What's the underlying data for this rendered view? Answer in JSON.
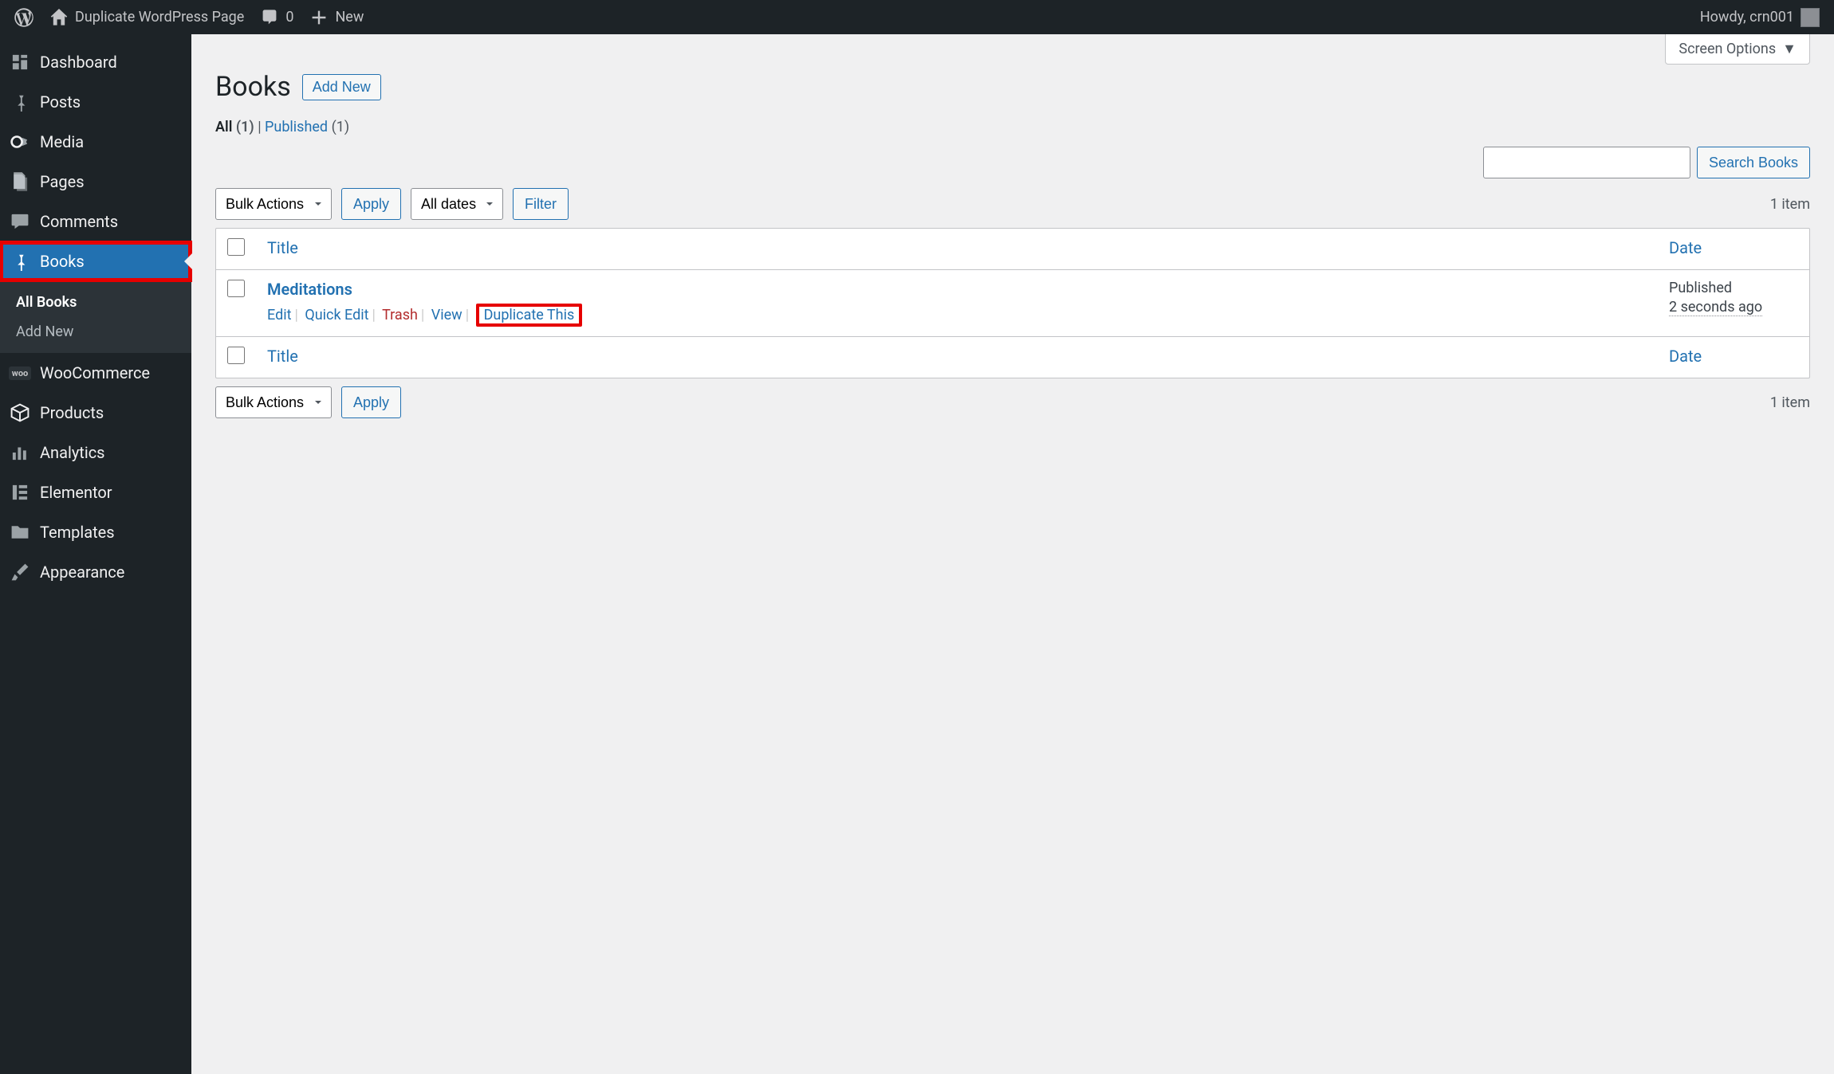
{
  "adminbar": {
    "site_title": "Duplicate WordPress Page",
    "comments_count": "0",
    "new_label": "New",
    "howdy": "Howdy, crn001"
  },
  "sidebar": {
    "items": [
      {
        "label": "Dashboard",
        "icon": "dashboard"
      },
      {
        "label": "Posts",
        "icon": "pin"
      },
      {
        "label": "Media",
        "icon": "media"
      },
      {
        "label": "Pages",
        "icon": "pages"
      },
      {
        "label": "Comments",
        "icon": "comment"
      },
      {
        "label": "Books",
        "icon": "pin",
        "current": true,
        "highlight": true
      },
      {
        "label": "WooCommerce",
        "icon": "woo"
      },
      {
        "label": "Products",
        "icon": "product"
      },
      {
        "label": "Analytics",
        "icon": "analytics"
      },
      {
        "label": "Elementor",
        "icon": "elementor"
      },
      {
        "label": "Templates",
        "icon": "folder"
      },
      {
        "label": "Appearance",
        "icon": "brush"
      }
    ],
    "submenu": [
      {
        "label": "All Books",
        "current": true
      },
      {
        "label": "Add New"
      }
    ]
  },
  "screen_options": "Screen Options",
  "page_title": "Books",
  "add_new": "Add New",
  "filters": {
    "all_label": "All",
    "all_count": "(1)",
    "published_label": "Published",
    "published_count": "(1)"
  },
  "search_btn": "Search Books",
  "bulk_actions": "Bulk Actions",
  "apply": "Apply",
  "all_dates": "All dates",
  "filter": "Filter",
  "item_count": "1 item",
  "columns": {
    "title": "Title",
    "date": "Date"
  },
  "rows": [
    {
      "title": "Meditations",
      "actions": {
        "edit": "Edit",
        "quick_edit": "Quick Edit",
        "trash": "Trash",
        "view": "View",
        "duplicate": "Duplicate This"
      },
      "date_state": "Published",
      "date_time": "2 seconds ago"
    }
  ]
}
